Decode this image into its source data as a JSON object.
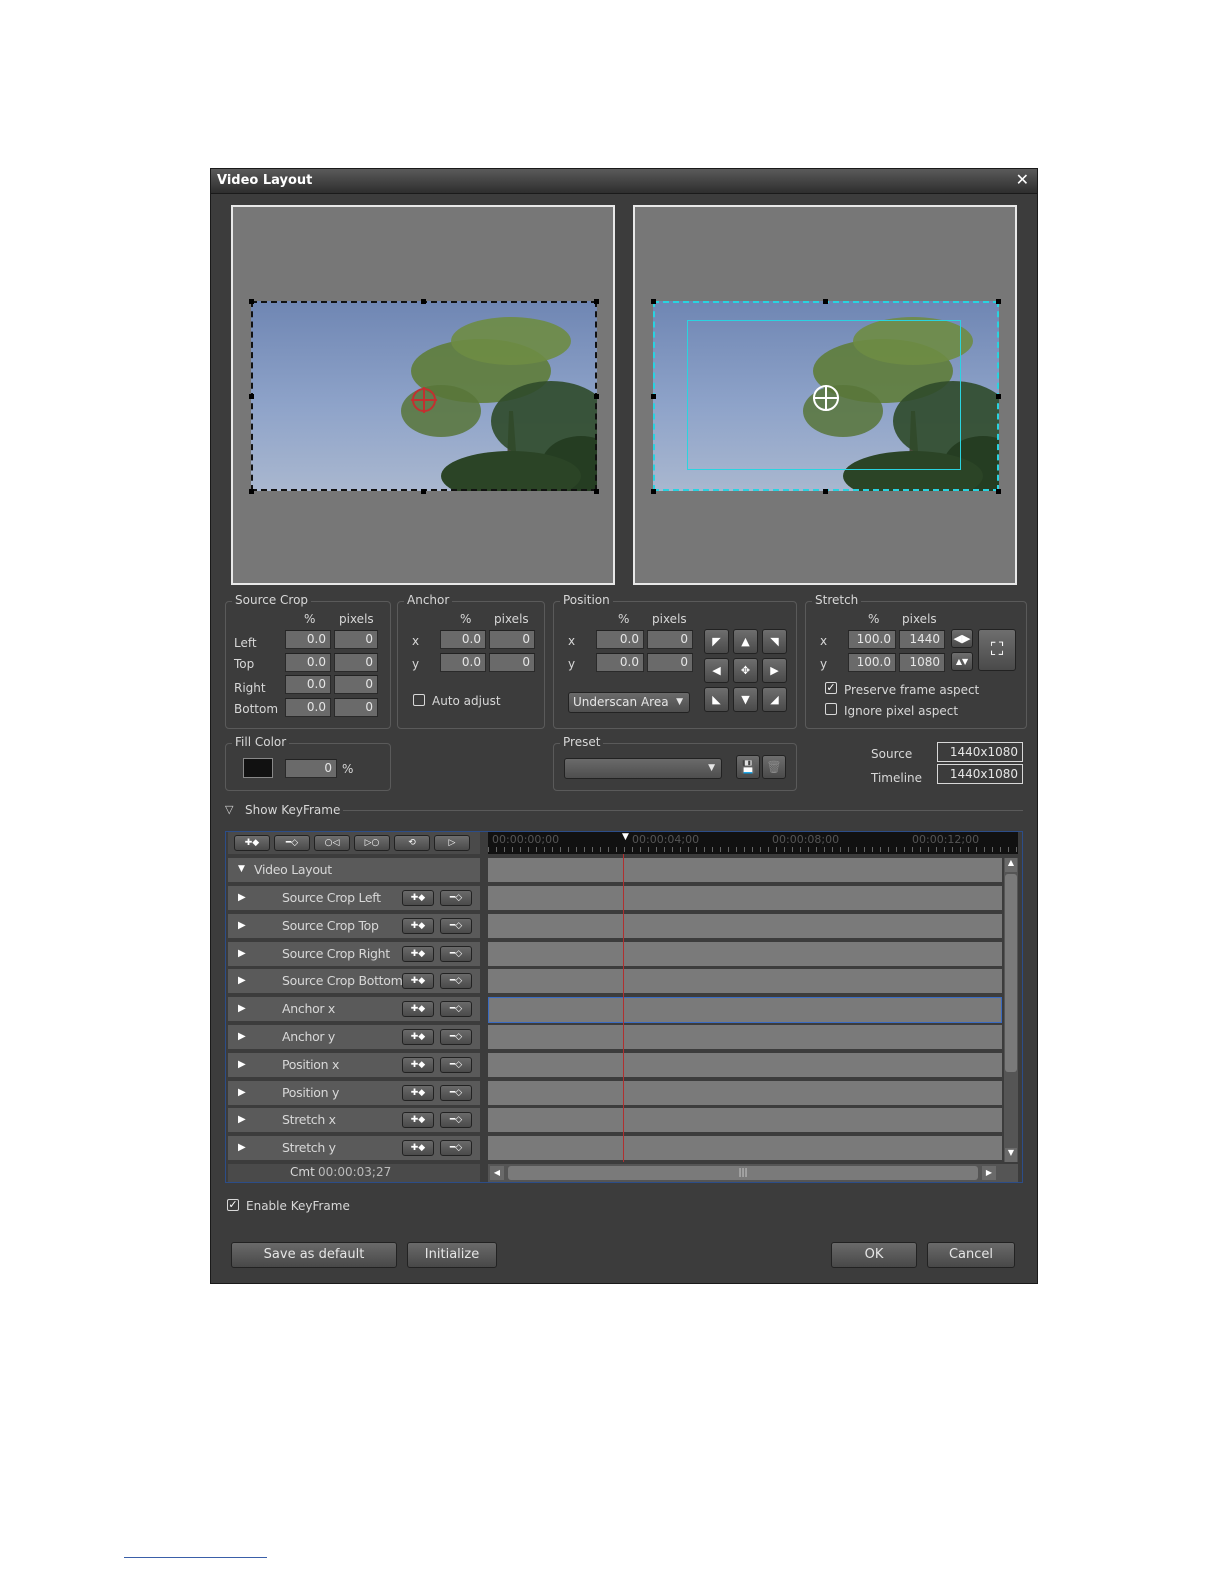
{
  "dialog": {
    "title": "Video Layout",
    "close_glyph": "✕"
  },
  "source_crop": {
    "label": "Source Crop",
    "col_pct": "%",
    "col_px": "pixels",
    "rows": [
      {
        "label": "Left",
        "pct": "0.0",
        "px": "0"
      },
      {
        "label": "Top",
        "pct": "0.0",
        "px": "0"
      },
      {
        "label": "Right",
        "pct": "0.0",
        "px": "0"
      },
      {
        "label": "Bottom",
        "pct": "0.0",
        "px": "0"
      }
    ]
  },
  "anchor": {
    "label": "Anchor",
    "col_pct": "%",
    "col_px": "pixels",
    "x": {
      "label": "x",
      "pct": "0.0",
      "px": "0"
    },
    "y": {
      "label": "y",
      "pct": "0.0",
      "px": "0"
    },
    "auto_adjust": "Auto adjust"
  },
  "position": {
    "label": "Position",
    "col_pct": "%",
    "col_px": "pixels",
    "x": {
      "label": "x",
      "pct": "0.0",
      "px": "0"
    },
    "y": {
      "label": "y",
      "pct": "0.0",
      "px": "0"
    },
    "area_select": "Underscan Area"
  },
  "stretch": {
    "label": "Stretch",
    "col_pct": "%",
    "col_px": "pixels",
    "x": {
      "label": "x",
      "pct": "100.0",
      "px": "1440"
    },
    "y": {
      "label": "y",
      "pct": "100.0",
      "px": "1080"
    },
    "preserve_frame_aspect": "Preserve frame aspect",
    "ignore_pixel_aspect": "Ignore pixel aspect"
  },
  "fill_color": {
    "label": "Fill Color",
    "value": "0",
    "unit": "%",
    "swatch": "#111111"
  },
  "preset": {
    "label": "Preset",
    "value": ""
  },
  "info": {
    "source_label": "Source",
    "source_value": "1440x1080",
    "timeline_label": "Timeline",
    "timeline_value": "1440x1080"
  },
  "show_keyframe": "Show KeyFrame",
  "keyframe": {
    "group_label": "Video Layout",
    "rows": [
      "Source Crop Left",
      "Source Crop Top",
      "Source Crop Right",
      "Source Crop Bottom",
      "Anchor x",
      "Anchor y",
      "Position x",
      "Position y",
      "Stretch x",
      "Stretch y"
    ],
    "ruler": [
      "00:00:00;00",
      "00:00:04;00",
      "00:00:08;00",
      "00:00:12;00"
    ],
    "cmt_label": "Cmt",
    "cmt_value": "00:00:03;27"
  },
  "enable_keyframe": "Enable KeyFrame",
  "buttons": {
    "save_default": "Save as default",
    "initialize": "Initialize",
    "ok": "OK",
    "cancel": "Cancel"
  }
}
